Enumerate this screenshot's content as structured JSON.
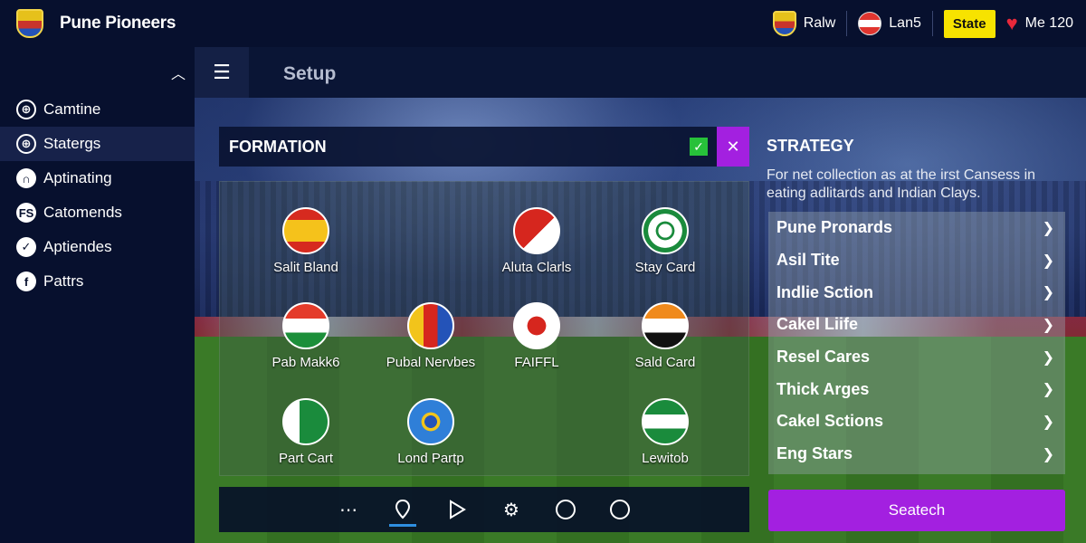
{
  "header": {
    "brand_title": "Pune Pioneers",
    "user_name": "Ralw",
    "opponent_name": "Lan5",
    "state_label": "State",
    "lives_label": "Me 120"
  },
  "sidebar": {
    "items": [
      {
        "label": "Camtine",
        "icon": "globe-icon"
      },
      {
        "label": "Statergs",
        "icon": "globe-icon",
        "active": true
      },
      {
        "label": "Aptinating",
        "icon": "magnet-icon"
      },
      {
        "label": "Catomends",
        "icon": "fs-icon"
      },
      {
        "label": "Aptiendes",
        "icon": "check-icon"
      },
      {
        "label": "Pattrs",
        "icon": "facebook-icon"
      }
    ]
  },
  "setup": {
    "title": "Setup"
  },
  "formation": {
    "title": "FORMATION",
    "players": [
      {
        "name": "Salit Bland"
      },
      {
        "name": "Aluta Clarls"
      },
      {
        "name": "Stay Card"
      },
      {
        "name": "Pab Makk6"
      },
      {
        "name": "Pubal Nervbes"
      },
      {
        "name": "FAIFFL"
      },
      {
        "name": "Sald Card"
      },
      {
        "name": "Part Cart"
      },
      {
        "name": "Lond Partp"
      },
      {
        "name": "Lewitob"
      }
    ]
  },
  "toolbar": {
    "icons": [
      "more-icon",
      "location-icon",
      "play-icon",
      "gear-icon",
      "ball-icon",
      "chat-icon"
    ]
  },
  "strategy": {
    "title": "STRATEGY",
    "description": "For net collection as at the irst Cansess in eating adlitards and Indian Clays.",
    "items": [
      {
        "label": "Pune Pronards"
      },
      {
        "label": "Asil Tite"
      },
      {
        "label": "Indlie Sction"
      },
      {
        "label": "Cakel Liife"
      },
      {
        "label": "Resel Cares"
      },
      {
        "label": "Thick Arges"
      },
      {
        "label": "Cakel Sctions"
      },
      {
        "label": "Eng Stars"
      }
    ],
    "button_label": "Seatech"
  },
  "colors": {
    "accent_purple": "#a320e0",
    "state_yellow": "#f7e300",
    "check_green": "#27c13a",
    "heart_red": "#e8283b"
  }
}
